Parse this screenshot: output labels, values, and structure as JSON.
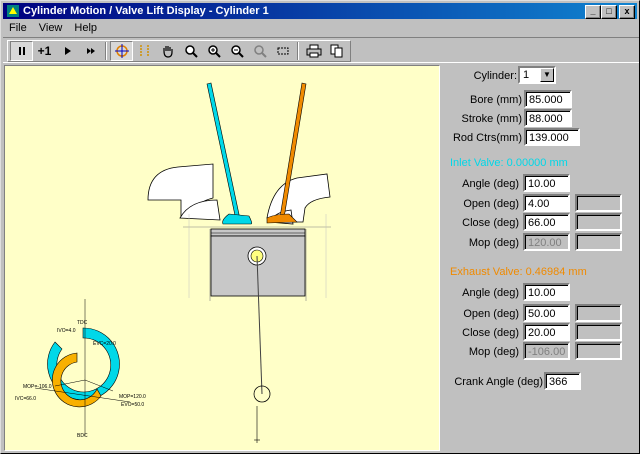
{
  "window": {
    "title": "Cylinder Motion / Valve Lift Display - Cylinder 1",
    "controls": {
      "minimize": "_",
      "maximize": "□",
      "close": "x"
    }
  },
  "menu": {
    "file": "File",
    "view": "View",
    "help": "Help"
  },
  "toolbar": {
    "pause_icon": "pause-icon",
    "step_label": "+1",
    "play_icon": "play-icon",
    "fast_forward_icon": "fast-forward-icon",
    "zoom_icons": [
      "hand-icon",
      "zoom-icon",
      "zoom-in-icon",
      "zoom-out-icon",
      "zoom-disabled-icon",
      "zoom-rect-icon"
    ],
    "print_icon": "printer-icon",
    "copy_icon": "copy-icon"
  },
  "diagram": {
    "tdc_label": "TDC",
    "bdc_label": "BDC",
    "ivo_label": "IVO=4.0",
    "evc_label": "EVC=20.0",
    "ivc_label": "IVC=66.0",
    "evo_label": "EVO=50.0",
    "mop_exhaust_label": "MOP=-106.0",
    "mop_intake_label": "MOP=120.0",
    "colors": {
      "intake": "#00c8d8",
      "exhaust": "#e88000",
      "cylinder": "#c0c0c0",
      "background": "#ffffc8"
    }
  },
  "panel": {
    "cylinder": {
      "label": "Cylinder:",
      "value": "1"
    },
    "bore": {
      "label": "Bore (mm)",
      "value": "85.000"
    },
    "stroke": {
      "label": "Stroke (mm)",
      "value": "88.000"
    },
    "rod": {
      "label": "Rod Ctrs(mm)",
      "value": "139.000"
    },
    "intake": {
      "title": "Inlet Valve: 0.00000 mm",
      "angle": {
        "label": "Angle (deg)",
        "value": "10.00"
      },
      "open": {
        "label": "Open (deg)",
        "value": "4.00"
      },
      "close": {
        "label": "Close (deg)",
        "value": "66.00"
      },
      "mop": {
        "label": "Mop (deg)",
        "value": "120.00"
      }
    },
    "exhaust": {
      "title": "Exhaust Valve: 0.46984 mm",
      "angle": {
        "label": "Angle (deg)",
        "value": "10.00"
      },
      "open": {
        "label": "Open (deg)",
        "value": "50.00"
      },
      "close": {
        "label": "Close (deg)",
        "value": "20.00"
      },
      "mop": {
        "label": "Mop (deg)",
        "value": "-106.00"
      }
    },
    "crank": {
      "label": "Crank Angle (deg)",
      "value": "366"
    }
  }
}
